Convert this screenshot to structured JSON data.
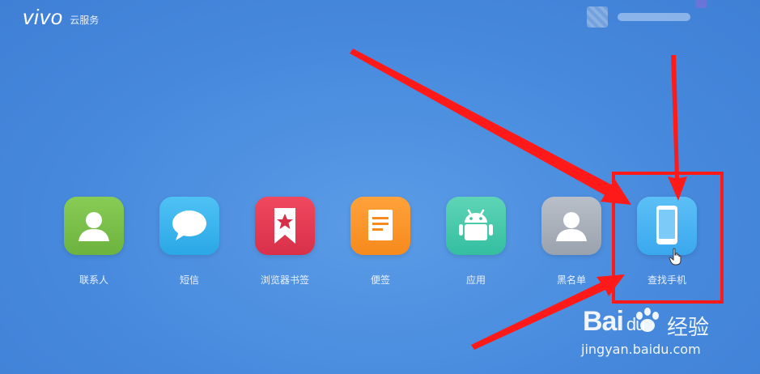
{
  "header": {
    "logo": "vivo",
    "service": "云服务"
  },
  "apps": [
    {
      "label": "联系人",
      "icon": "contacts-icon",
      "color": "#6cb33f"
    },
    {
      "label": "短信",
      "icon": "message-icon",
      "color": "#2aa7e6"
    },
    {
      "label": "浏览器书签",
      "icon": "bookmark-icon",
      "color": "#d9304a"
    },
    {
      "label": "便签",
      "icon": "note-icon",
      "color": "#f68a1d"
    },
    {
      "label": "应用",
      "icon": "android-icon",
      "color": "#34bea0"
    },
    {
      "label": "黑名单",
      "icon": "blacklist-icon",
      "color": "#9aa2ad"
    },
    {
      "label": "查找手机",
      "icon": "phone-icon",
      "color": "#3aa8ee"
    }
  ],
  "highlight_color": "#ff1a1a",
  "background_color": "#4a8fe0",
  "watermark": {
    "brand": "Bai",
    "brand_suffix": "du",
    "suffix": "经验",
    "url": "jingyan.baidu.com"
  }
}
